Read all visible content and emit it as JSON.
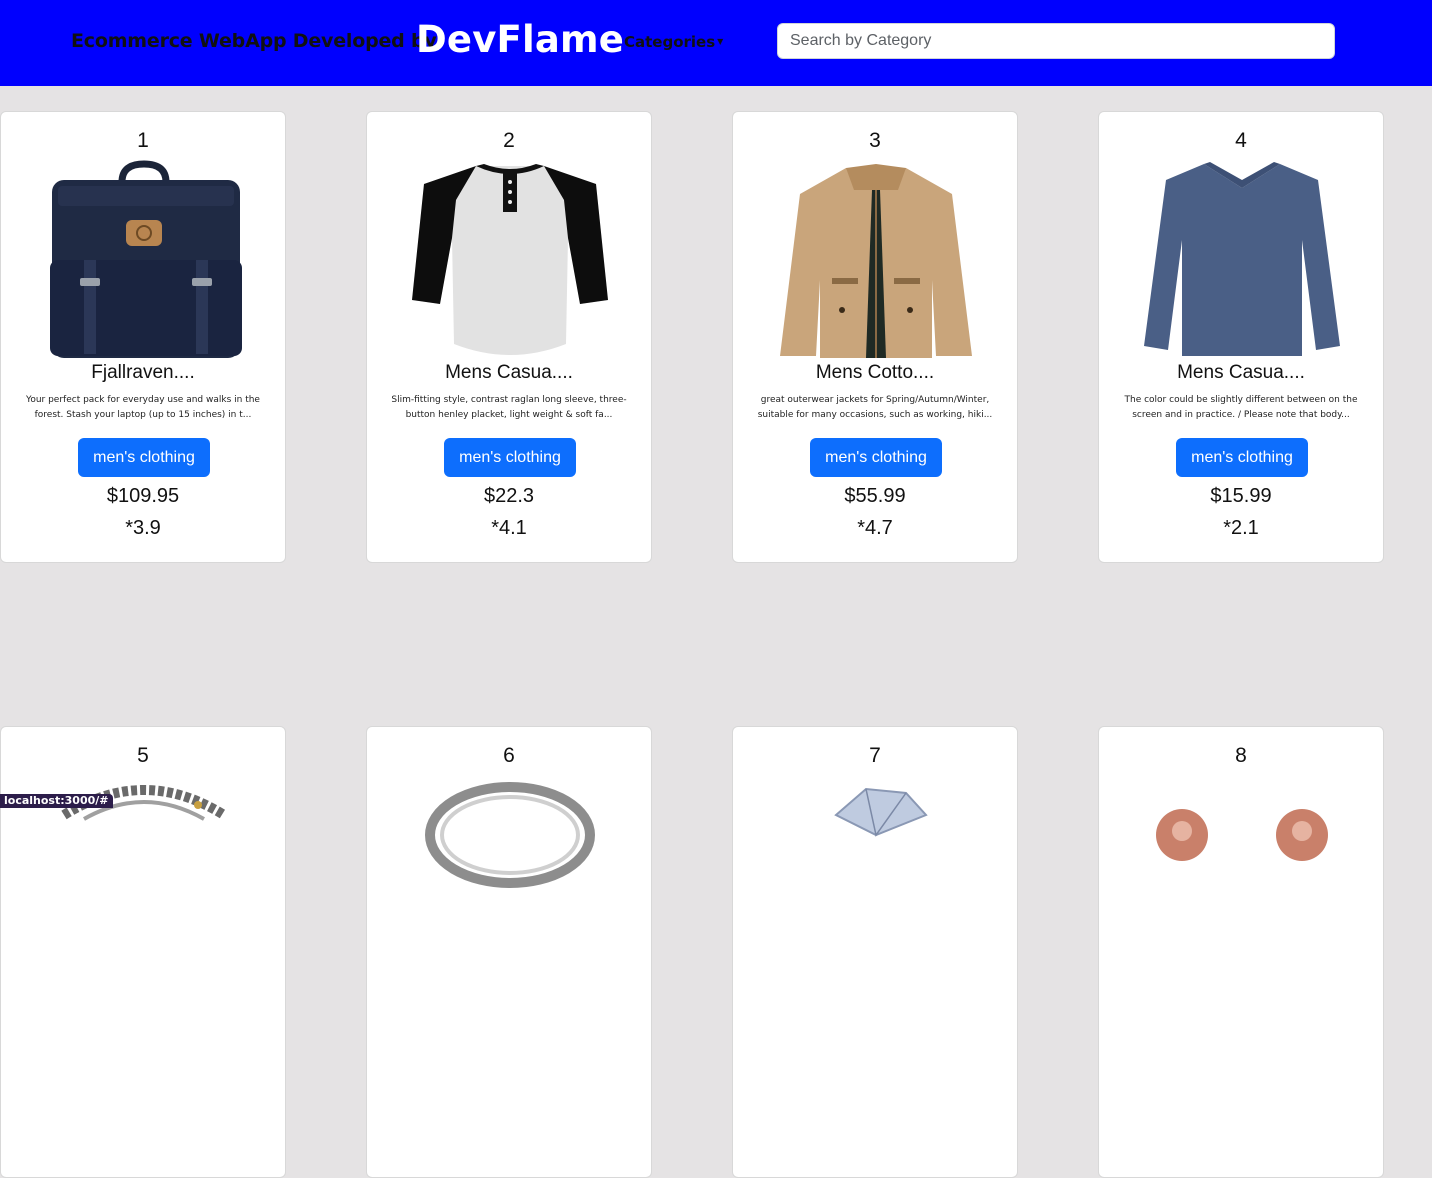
{
  "header": {
    "brand_prefix": "Ecommerce WebApp Developed by",
    "brand_name": "DevFlame",
    "categories_label": "Categories",
    "search_placeholder": "Search by Category"
  },
  "colors": {
    "header_bg": "#0000fe",
    "category_button": "#0d6efd",
    "page_bg": "#e5e3e4"
  },
  "products": [
    {
      "index": "1",
      "title": "Fjallraven....",
      "description": "Your perfect pack for everyday use and walks in the forest. Stash your laptop (up to 15 inches) in t...",
      "category": "men's clothing",
      "price": "$109.95",
      "rating": "*3.9",
      "image": "backpack"
    },
    {
      "index": "2",
      "title": "Mens Casua....",
      "description": "Slim-fitting style, contrast raglan long sleeve, three-button henley placket, light weight & soft fa...",
      "category": "men's clothing",
      "price": "$22.3",
      "rating": "*4.1",
      "image": "raglan-tshirt"
    },
    {
      "index": "3",
      "title": "Mens Cotto....",
      "description": "great outerwear jackets for Spring/Autumn/Winter, suitable for many occasions, such as working, hiki...",
      "category": "men's clothing",
      "price": "$55.99",
      "rating": "*4.7",
      "image": "jacket"
    },
    {
      "index": "4",
      "title": "Mens Casua....",
      "description": "The color could be slightly different between on the screen and in practice. / Please note that body...",
      "category": "men's clothing",
      "price": "$15.99",
      "rating": "*2.1",
      "image": "long-sleeve-shirt"
    },
    {
      "index": "5",
      "image": "bracelet"
    },
    {
      "index": "6",
      "image": "ring"
    },
    {
      "index": "7",
      "image": "diamond-ring"
    },
    {
      "index": "8",
      "image": "earrings"
    }
  ],
  "status_bar": "localhost:3000/#"
}
